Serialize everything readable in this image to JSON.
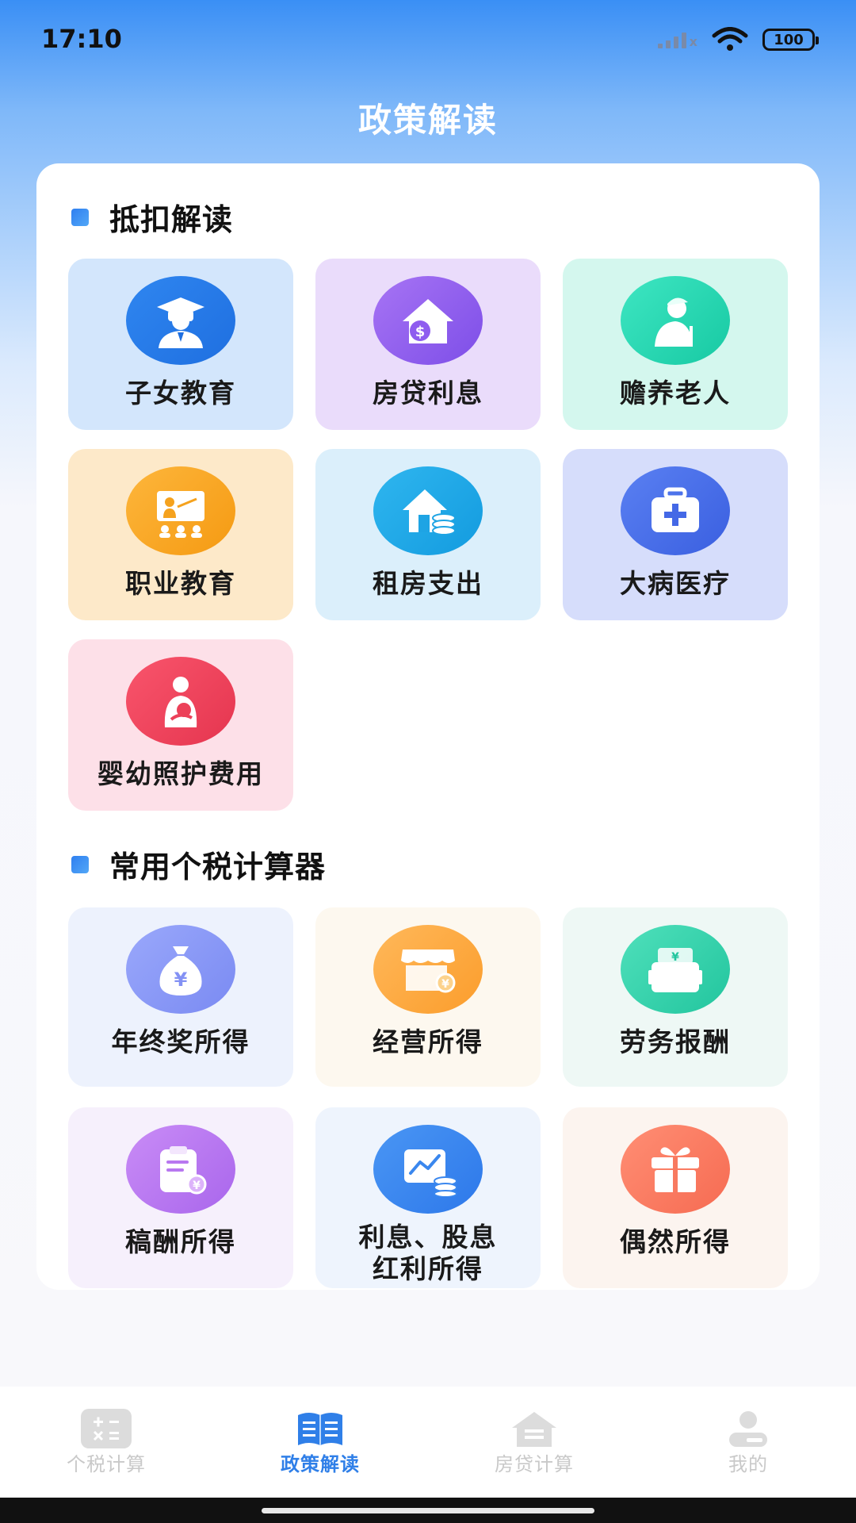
{
  "status_bar": {
    "time": "17:10",
    "battery": "100"
  },
  "header": {
    "title": "政策解读"
  },
  "deductions": {
    "title": "抵扣解读",
    "items": [
      {
        "label": "子女教育",
        "icon": "graduate-icon"
      },
      {
        "label": "房贷利息",
        "icon": "house-money-icon"
      },
      {
        "label": "赡养老人",
        "icon": "elderly-icon"
      },
      {
        "label": "职业教育",
        "icon": "teacher-board-icon"
      },
      {
        "label": "租房支出",
        "icon": "rent-house-coins-icon"
      },
      {
        "label": "大病医疗",
        "icon": "medical-kit-icon"
      },
      {
        "label": "婴幼照护费用",
        "icon": "mother-baby-icon"
      }
    ]
  },
  "calculators": {
    "title": "常用个税计算器",
    "items": [
      {
        "label": "年终奖所得",
        "icon": "money-bag-icon"
      },
      {
        "label": "经营所得",
        "icon": "shop-icon"
      },
      {
        "label": "劳务报酬",
        "icon": "briefcase-yen-icon"
      },
      {
        "label": "稿酬所得",
        "icon": "clipboard-yen-icon"
      },
      {
        "label_line1": "利息、股息",
        "label_line2": "红利所得",
        "icon": "chart-coins-icon"
      },
      {
        "label": "偶然所得",
        "icon": "gift-icon"
      }
    ]
  },
  "bottom_nav": {
    "items": [
      {
        "label": "个税计算",
        "icon": "calculator-icon",
        "active": false
      },
      {
        "label": "政策解读",
        "icon": "book-icon",
        "active": true
      },
      {
        "label": "房贷计算",
        "icon": "house-icon",
        "active": false
      },
      {
        "label": "我的",
        "icon": "user-icon",
        "active": false
      }
    ]
  },
  "colors": {
    "accent": "#2f7fe8",
    "tile_bg": [
      "#d3e6fc",
      "#eadcfb",
      "#d4f7ee",
      "#fde9c9",
      "#dbeffb",
      "#d6ddfb",
      "#fde0e8"
    ],
    "calc_tile_bg": [
      "#edf2fd",
      "#fdf8ef",
      "#eef8f5",
      "#f6f0fc",
      "#eef4fd",
      "#fcf4ef"
    ]
  }
}
